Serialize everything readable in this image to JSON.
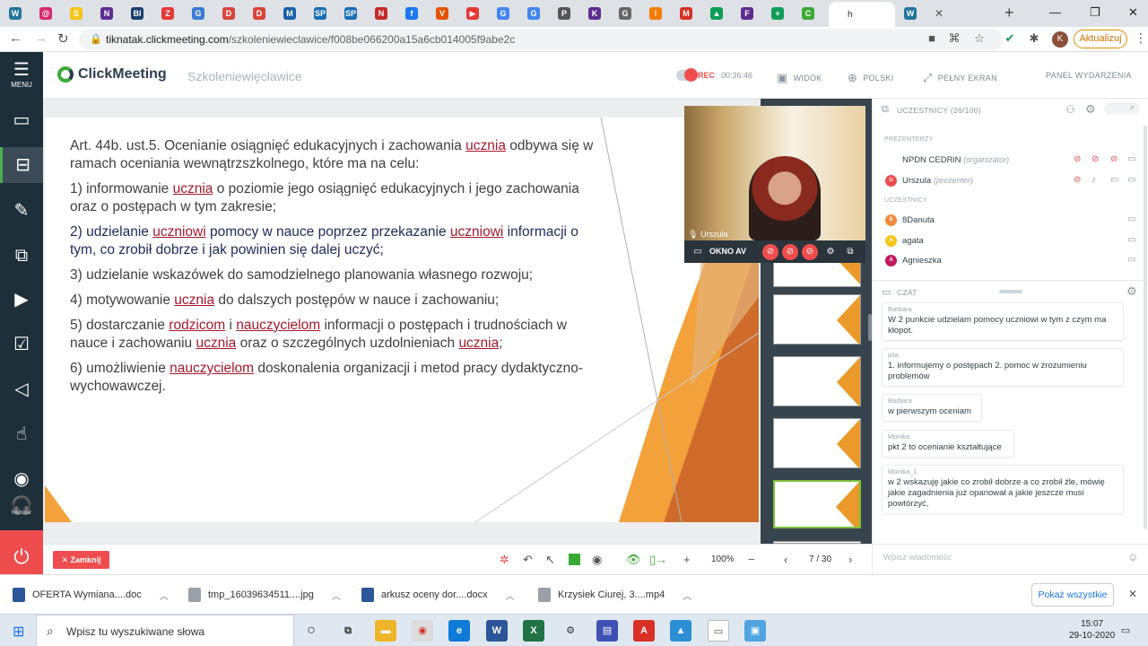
{
  "browser": {
    "tabs": [
      {
        "fav": "W",
        "color": "#21759b"
      },
      {
        "fav": "@",
        "color": "#d6286e"
      },
      {
        "fav": "S",
        "color": "#f5c518"
      },
      {
        "fav": "N",
        "color": "#5c2d91"
      },
      {
        "fav": "BI",
        "color": "#1a3d6d"
      },
      {
        "fav": "Z",
        "color": "#e53935"
      },
      {
        "fav": "G",
        "color": "#3a7bd5"
      },
      {
        "fav": "D",
        "color": "#d9453b"
      },
      {
        "fav": "D",
        "color": "#d9453b"
      },
      {
        "fav": "M",
        "color": "#1a5fa8"
      },
      {
        "fav": "SP",
        "color": "#1a6fb5"
      },
      {
        "fav": "SP",
        "color": "#1a6fb5"
      },
      {
        "fav": "N",
        "color": "#c62828"
      },
      {
        "fav": "f",
        "color": "#1877f2"
      },
      {
        "fav": "V",
        "color": "#e65100"
      },
      {
        "fav": "▶",
        "color": "#e53935"
      },
      {
        "fav": "G",
        "color": "#4285f4"
      },
      {
        "fav": "G",
        "color": "#4285f4"
      },
      {
        "fav": "P",
        "color": "#555"
      },
      {
        "fav": "K",
        "color": "#5c2d91"
      },
      {
        "fav": "G",
        "color": "#666"
      },
      {
        "fav": "!",
        "color": "#f57c00"
      },
      {
        "fav": "M",
        "color": "#d93025"
      },
      {
        "fav": "▲",
        "color": "#0f9d58"
      },
      {
        "fav": "F",
        "color": "#5c2d91"
      },
      {
        "fav": "+",
        "color": "#0f9d58"
      },
      {
        "fav": "C",
        "color": "#3aaa35"
      },
      {
        "fav": "",
        "color": "#fff"
      },
      {
        "fav": "W",
        "color": "#21759b"
      }
    ],
    "active_tab_label": "h",
    "url_host": "tiknatak.clickmeeting.com",
    "url_path": "/szkoleniewieclawice/f008be066200a15a6cb014005f9abe2c",
    "update_label": "Aktualizuj",
    "profile_initial": "K"
  },
  "sidebar": {
    "menu_label": "MENU",
    "webinar_label": "Webinar"
  },
  "header": {
    "logo_text": "ClickMeeting",
    "event_title": "Szkoleniewięcławice",
    "rec_label": "REC",
    "rec_time": "00:36:46",
    "view_label": "WIDOK",
    "language_label": "POLSKI",
    "fullscreen_label": "PEŁNY EKRAN",
    "panel_label": "PANEL WYDARZENIA"
  },
  "slide": {
    "p1_a": "Art. 44b. ust.5. Ocenianie osiągnięć edukacyjnych i zachowania ",
    "p1_u": "ucznia",
    "p1_b": " odbywa się w ramach oceniania wewnątrzszkolnego, które ma na celu:",
    "p2_a": "1) informowanie ",
    "p2_u": "ucznia",
    "p2_b": " o poziomie jego osiągnięć edukacyjnych i jego zachowania oraz o postępach w tym zakresie;",
    "p3_a": "2) udzielanie ",
    "p3_u1": "uczniowi",
    "p3_b": " pomocy w nauce poprzez przekazanie ",
    "p3_u2": "uczniowi",
    "p3_c": " informacji o tym, co zrobił dobrze i jak powinien się dalej uczyć;",
    "p4": "3) udzielanie wskazówek do samodzielnego planowania własnego rozwoju;",
    "p5_a": "4) motywowanie ",
    "p5_u": "ucznia",
    "p5_b": " do dalszych postępów w nauce i zachowaniu;",
    "p6_a": "5) dostarczanie ",
    "p6_u1": "rodzicom",
    "p6_b": " i ",
    "p6_u2": "nauczycielom",
    "p6_c": " informacji o postępach i trudnościach w nauce i zachowaniu ",
    "p6_u3": "ucznia",
    "p6_d": " oraz o szczególnych uzdolnieniach ",
    "p6_u4": "ucznia",
    "p6_e": ";",
    "p7_a": "6) umożliwienie ",
    "p7_u": "nauczycielom",
    "p7_b": " doskonalenia organizacji i metod pracy dydaktyczno-wychowawczej."
  },
  "webcam": {
    "name": "Urszula",
    "av_label": "OKNO AV"
  },
  "controls": {
    "close_label": "Zamknij",
    "zoom": "100%",
    "page": "7 / 30"
  },
  "participants": {
    "title": "UCZESTNICY (26/100)",
    "presenters_label": "PREZENTERZY",
    "attendees_label": "UCZESTNICY",
    "presenters": [
      {
        "name": "NPDN CEDRiN",
        "role": "(organizator)",
        "initial": "",
        "color": "#fff"
      },
      {
        "name": "Urszula",
        "role": "(prezenter)",
        "initial": "U",
        "color": "#ef4d4d"
      }
    ],
    "attendees": [
      {
        "name": "8Danuta",
        "initial": "8",
        "color": "#f08a3c"
      },
      {
        "name": "agata",
        "initial": "A",
        "color": "#f5c518"
      },
      {
        "name": "Agnieszka",
        "initial": "A",
        "color": "#c2185b"
      }
    ]
  },
  "chat": {
    "title": "CZAT",
    "messages": [
      {
        "author": "Barbara",
        "text": "W 2 punkcie udzielam pomocy uczniowi w tym z czym ma kłopot."
      },
      {
        "author": "jola",
        "text": "1. informujemy o postępach 2. pomoc w zrozumieniu problemów"
      },
      {
        "author": "Barbara",
        "text": "w pierwszym oceniam"
      },
      {
        "author": "Monika",
        "text": "pkt 2 to ocenianie kształtujące"
      },
      {
        "author": "Monika_1",
        "text": "w 2 wskazuję jakie co zrobił dobrze a co zrobił źle, mówię jakie zagadnienia już opanował a jakie jeszcze musi powtórzyć,"
      }
    ],
    "input_placeholder": "Wpisz wiadomość"
  },
  "downloads": {
    "items": [
      {
        "name": "OFERTA Wymiana....doc",
        "color": "#2b579a"
      },
      {
        "name": "tmp_16039634511....jpg",
        "color": "#5f6368"
      },
      {
        "name": "arkusz oceny dor....docx",
        "color": "#2b579a"
      },
      {
        "name": "Krzysiek Ciurej, 3....mp4",
        "color": "#5f6368"
      }
    ],
    "show_all_label": "Pokaż wszystkie"
  },
  "taskbar": {
    "search_placeholder": "Wpisz tu wyszukiwane słowa",
    "time": "15:07",
    "date": "29-10-2020"
  }
}
